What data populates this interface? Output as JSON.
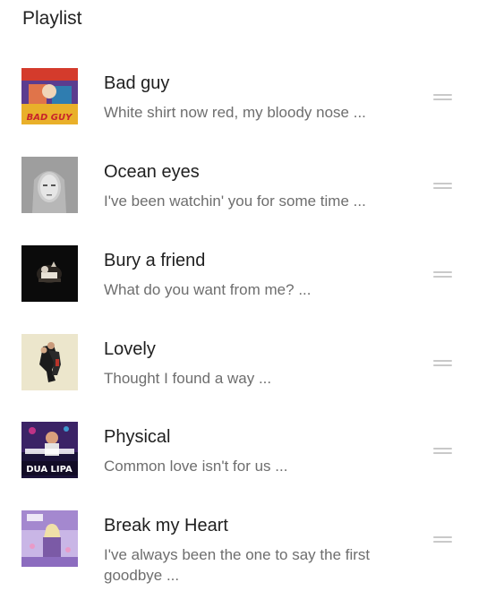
{
  "playlist": {
    "title": "Playlist",
    "items": [
      {
        "title": "Bad guy",
        "lyric": "White shirt now red, my bloody nose ...",
        "cover_icon": "bad-guy-album-cover",
        "cover_text": "BAD GUY"
      },
      {
        "title": "Ocean eyes",
        "lyric": "I've been watchin' you for some time ...",
        "cover_icon": "ocean-eyes-album-cover"
      },
      {
        "title": "Bury a friend",
        "lyric": "What do you want from me? ...",
        "cover_icon": "bury-a-friend-album-cover"
      },
      {
        "title": "Lovely",
        "lyric": "Thought I found a way ...",
        "cover_icon": "lovely-album-cover"
      },
      {
        "title": "Physical",
        "lyric": "Common love isn't for us ...",
        "cover_icon": "physical-album-cover",
        "cover_text": "DUA LIPA"
      },
      {
        "title": "Break my Heart",
        "lyric": "I've always been the one to say the first goodbye ...",
        "cover_icon": "break-my-heart-album-cover"
      }
    ]
  },
  "colors": {
    "title_text": "#1f1f1f",
    "lyric_text": "#6e6e6e",
    "drag_handle": "#c9c9c9"
  }
}
